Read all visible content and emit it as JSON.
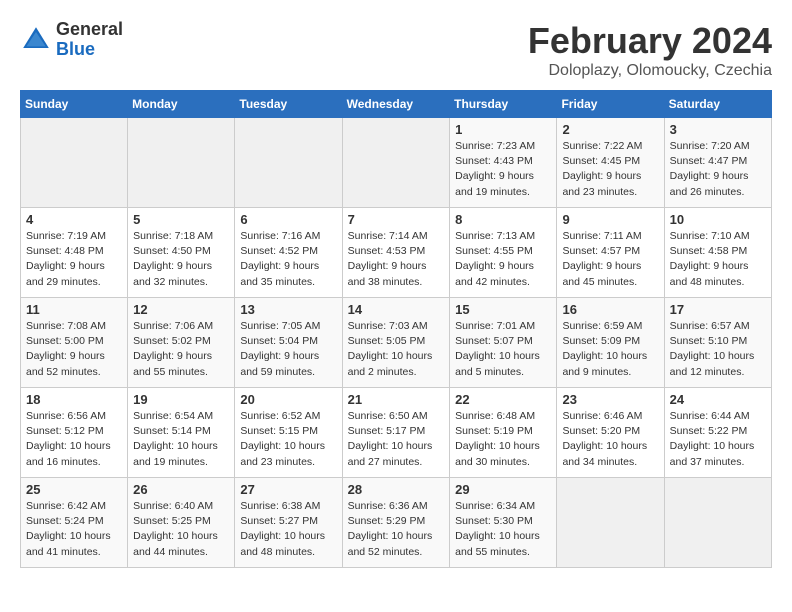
{
  "header": {
    "logo": {
      "general": "General",
      "blue": "Blue"
    },
    "title": "February 2024",
    "subtitle": "Doloplazy, Olomoucky, Czechia"
  },
  "weekdays": [
    "Sunday",
    "Monday",
    "Tuesday",
    "Wednesday",
    "Thursday",
    "Friday",
    "Saturday"
  ],
  "weeks": [
    [
      {
        "day": "",
        "info": ""
      },
      {
        "day": "",
        "info": ""
      },
      {
        "day": "",
        "info": ""
      },
      {
        "day": "",
        "info": ""
      },
      {
        "day": "1",
        "info": "Sunrise: 7:23 AM\nSunset: 4:43 PM\nDaylight: 9 hours\nand 19 minutes."
      },
      {
        "day": "2",
        "info": "Sunrise: 7:22 AM\nSunset: 4:45 PM\nDaylight: 9 hours\nand 23 minutes."
      },
      {
        "day": "3",
        "info": "Sunrise: 7:20 AM\nSunset: 4:47 PM\nDaylight: 9 hours\nand 26 minutes."
      }
    ],
    [
      {
        "day": "4",
        "info": "Sunrise: 7:19 AM\nSunset: 4:48 PM\nDaylight: 9 hours\nand 29 minutes."
      },
      {
        "day": "5",
        "info": "Sunrise: 7:18 AM\nSunset: 4:50 PM\nDaylight: 9 hours\nand 32 minutes."
      },
      {
        "day": "6",
        "info": "Sunrise: 7:16 AM\nSunset: 4:52 PM\nDaylight: 9 hours\nand 35 minutes."
      },
      {
        "day": "7",
        "info": "Sunrise: 7:14 AM\nSunset: 4:53 PM\nDaylight: 9 hours\nand 38 minutes."
      },
      {
        "day": "8",
        "info": "Sunrise: 7:13 AM\nSunset: 4:55 PM\nDaylight: 9 hours\nand 42 minutes."
      },
      {
        "day": "9",
        "info": "Sunrise: 7:11 AM\nSunset: 4:57 PM\nDaylight: 9 hours\nand 45 minutes."
      },
      {
        "day": "10",
        "info": "Sunrise: 7:10 AM\nSunset: 4:58 PM\nDaylight: 9 hours\nand 48 minutes."
      }
    ],
    [
      {
        "day": "11",
        "info": "Sunrise: 7:08 AM\nSunset: 5:00 PM\nDaylight: 9 hours\nand 52 minutes."
      },
      {
        "day": "12",
        "info": "Sunrise: 7:06 AM\nSunset: 5:02 PM\nDaylight: 9 hours\nand 55 minutes."
      },
      {
        "day": "13",
        "info": "Sunrise: 7:05 AM\nSunset: 5:04 PM\nDaylight: 9 hours\nand 59 minutes."
      },
      {
        "day": "14",
        "info": "Sunrise: 7:03 AM\nSunset: 5:05 PM\nDaylight: 10 hours\nand 2 minutes."
      },
      {
        "day": "15",
        "info": "Sunrise: 7:01 AM\nSunset: 5:07 PM\nDaylight: 10 hours\nand 5 minutes."
      },
      {
        "day": "16",
        "info": "Sunrise: 6:59 AM\nSunset: 5:09 PM\nDaylight: 10 hours\nand 9 minutes."
      },
      {
        "day": "17",
        "info": "Sunrise: 6:57 AM\nSunset: 5:10 PM\nDaylight: 10 hours\nand 12 minutes."
      }
    ],
    [
      {
        "day": "18",
        "info": "Sunrise: 6:56 AM\nSunset: 5:12 PM\nDaylight: 10 hours\nand 16 minutes."
      },
      {
        "day": "19",
        "info": "Sunrise: 6:54 AM\nSunset: 5:14 PM\nDaylight: 10 hours\nand 19 minutes."
      },
      {
        "day": "20",
        "info": "Sunrise: 6:52 AM\nSunset: 5:15 PM\nDaylight: 10 hours\nand 23 minutes."
      },
      {
        "day": "21",
        "info": "Sunrise: 6:50 AM\nSunset: 5:17 PM\nDaylight: 10 hours\nand 27 minutes."
      },
      {
        "day": "22",
        "info": "Sunrise: 6:48 AM\nSunset: 5:19 PM\nDaylight: 10 hours\nand 30 minutes."
      },
      {
        "day": "23",
        "info": "Sunrise: 6:46 AM\nSunset: 5:20 PM\nDaylight: 10 hours\nand 34 minutes."
      },
      {
        "day": "24",
        "info": "Sunrise: 6:44 AM\nSunset: 5:22 PM\nDaylight: 10 hours\nand 37 minutes."
      }
    ],
    [
      {
        "day": "25",
        "info": "Sunrise: 6:42 AM\nSunset: 5:24 PM\nDaylight: 10 hours\nand 41 minutes."
      },
      {
        "day": "26",
        "info": "Sunrise: 6:40 AM\nSunset: 5:25 PM\nDaylight: 10 hours\nand 44 minutes."
      },
      {
        "day": "27",
        "info": "Sunrise: 6:38 AM\nSunset: 5:27 PM\nDaylight: 10 hours\nand 48 minutes."
      },
      {
        "day": "28",
        "info": "Sunrise: 6:36 AM\nSunset: 5:29 PM\nDaylight: 10 hours\nand 52 minutes."
      },
      {
        "day": "29",
        "info": "Sunrise: 6:34 AM\nSunset: 5:30 PM\nDaylight: 10 hours\nand 55 minutes."
      },
      {
        "day": "",
        "info": ""
      },
      {
        "day": "",
        "info": ""
      }
    ]
  ]
}
